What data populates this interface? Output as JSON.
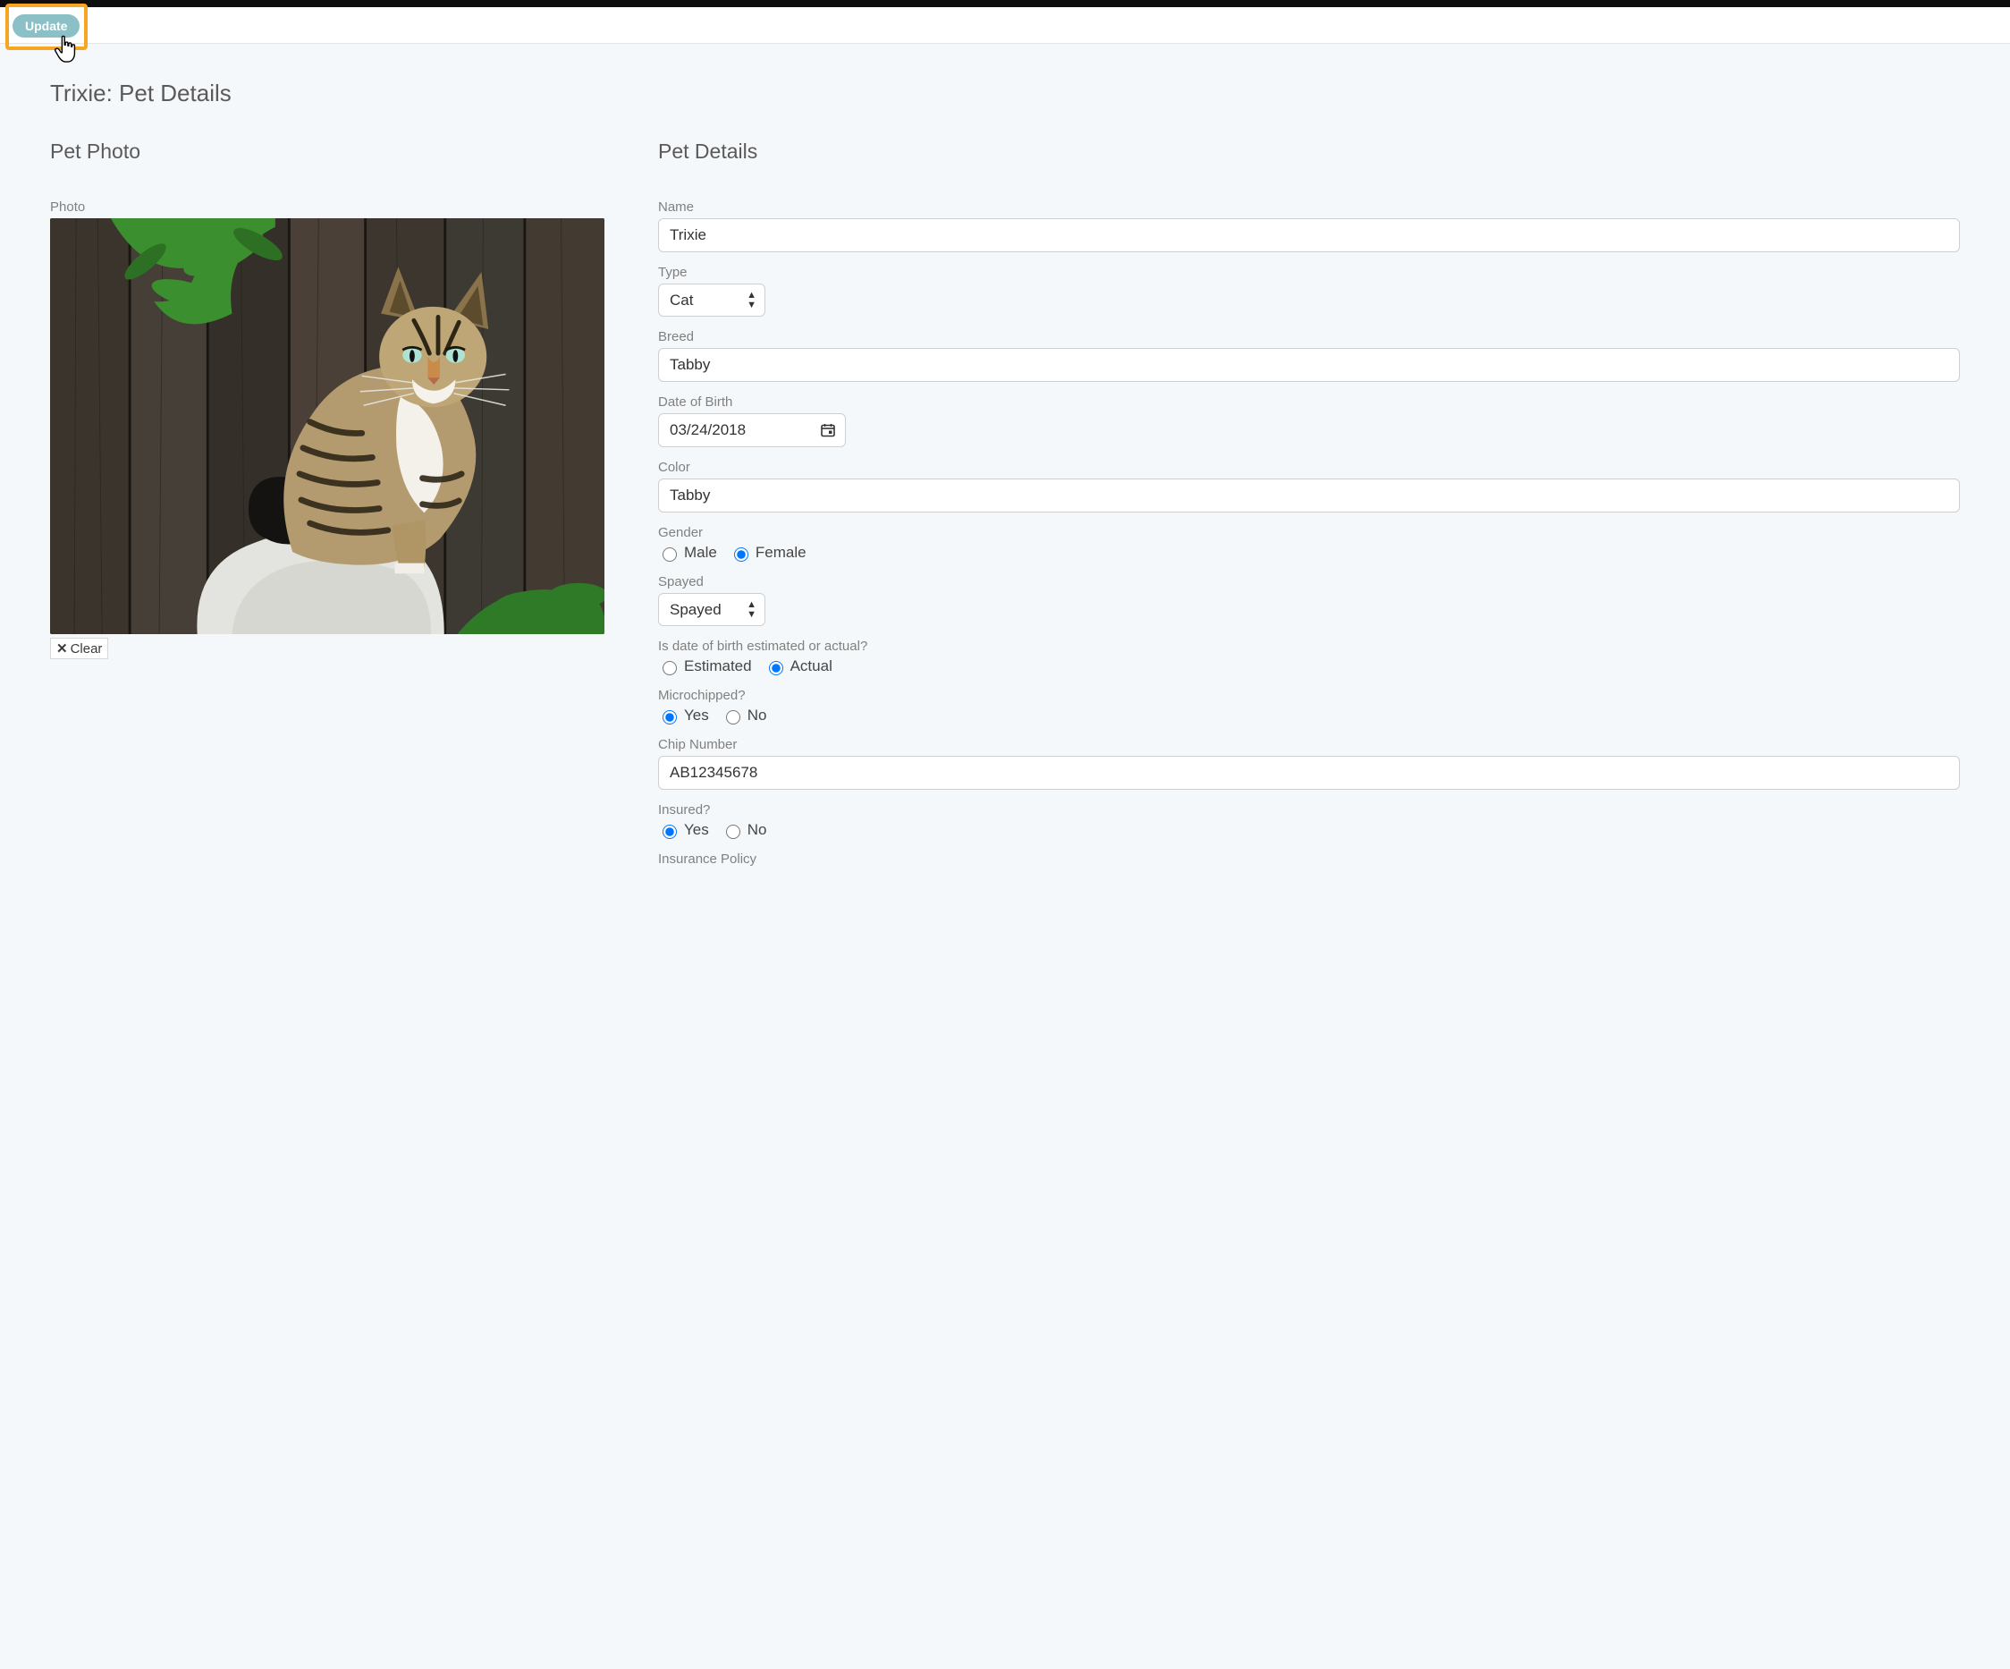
{
  "toolbar": {
    "update_label": "Update"
  },
  "page_title": "Trixie: Pet Details",
  "photo_section": {
    "title": "Pet Photo",
    "label": "Photo",
    "clear_label": "Clear"
  },
  "details": {
    "title": "Pet Details",
    "name": {
      "label": "Name",
      "value": "Trixie"
    },
    "type": {
      "label": "Type",
      "value": "Cat"
    },
    "breed": {
      "label": "Breed",
      "value": "Tabby"
    },
    "dob": {
      "label": "Date of Birth",
      "value": "03/24/2018"
    },
    "color": {
      "label": "Color",
      "value": "Tabby"
    },
    "gender": {
      "label": "Gender",
      "options": {
        "male": "Male",
        "female": "Female"
      },
      "selected": "female"
    },
    "spayed": {
      "label": "Spayed",
      "value": "Spayed"
    },
    "dob_kind": {
      "label": "Is date of birth estimated or actual?",
      "options": {
        "estimated": "Estimated",
        "actual": "Actual"
      },
      "selected": "actual"
    },
    "microchipped": {
      "label": "Microchipped?",
      "options": {
        "yes": "Yes",
        "no": "No"
      },
      "selected": "yes"
    },
    "chip_number": {
      "label": "Chip Number",
      "value": "AB12345678"
    },
    "insured": {
      "label": "Insured?",
      "options": {
        "yes": "Yes",
        "no": "No"
      },
      "selected": "yes"
    },
    "insurance_policy": {
      "label": "Insurance Policy"
    }
  }
}
